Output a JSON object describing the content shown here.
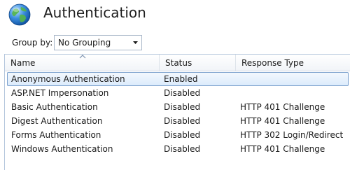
{
  "page": {
    "title": "Authentication",
    "icon": "globe-icon"
  },
  "toolbar": {
    "group_by_label": "Group by:",
    "group_by_value": "No Grouping"
  },
  "grid": {
    "columns": [
      "Name",
      "Status",
      "Response Type"
    ],
    "sorted_column": "Name",
    "rows": [
      {
        "name": "Anonymous Authentication",
        "status": "Enabled",
        "response_type": "",
        "selected": true
      },
      {
        "name": "ASP.NET Impersonation",
        "status": "Disabled",
        "response_type": ""
      },
      {
        "name": "Basic Authentication",
        "status": "Disabled",
        "response_type": "HTTP 401 Challenge"
      },
      {
        "name": "Digest Authentication",
        "status": "Disabled",
        "response_type": "HTTP 401 Challenge"
      },
      {
        "name": "Forms Authentication",
        "status": "Disabled",
        "response_type": "HTTP 302 Login/Redirect"
      },
      {
        "name": "Windows Authentication",
        "status": "Disabled",
        "response_type": "HTTP 401 Challenge"
      }
    ]
  },
  "colors": {
    "selection_border": "#7da2ce",
    "selection_fill": "#dcebfc",
    "grid_border": "#b4c6dc"
  }
}
